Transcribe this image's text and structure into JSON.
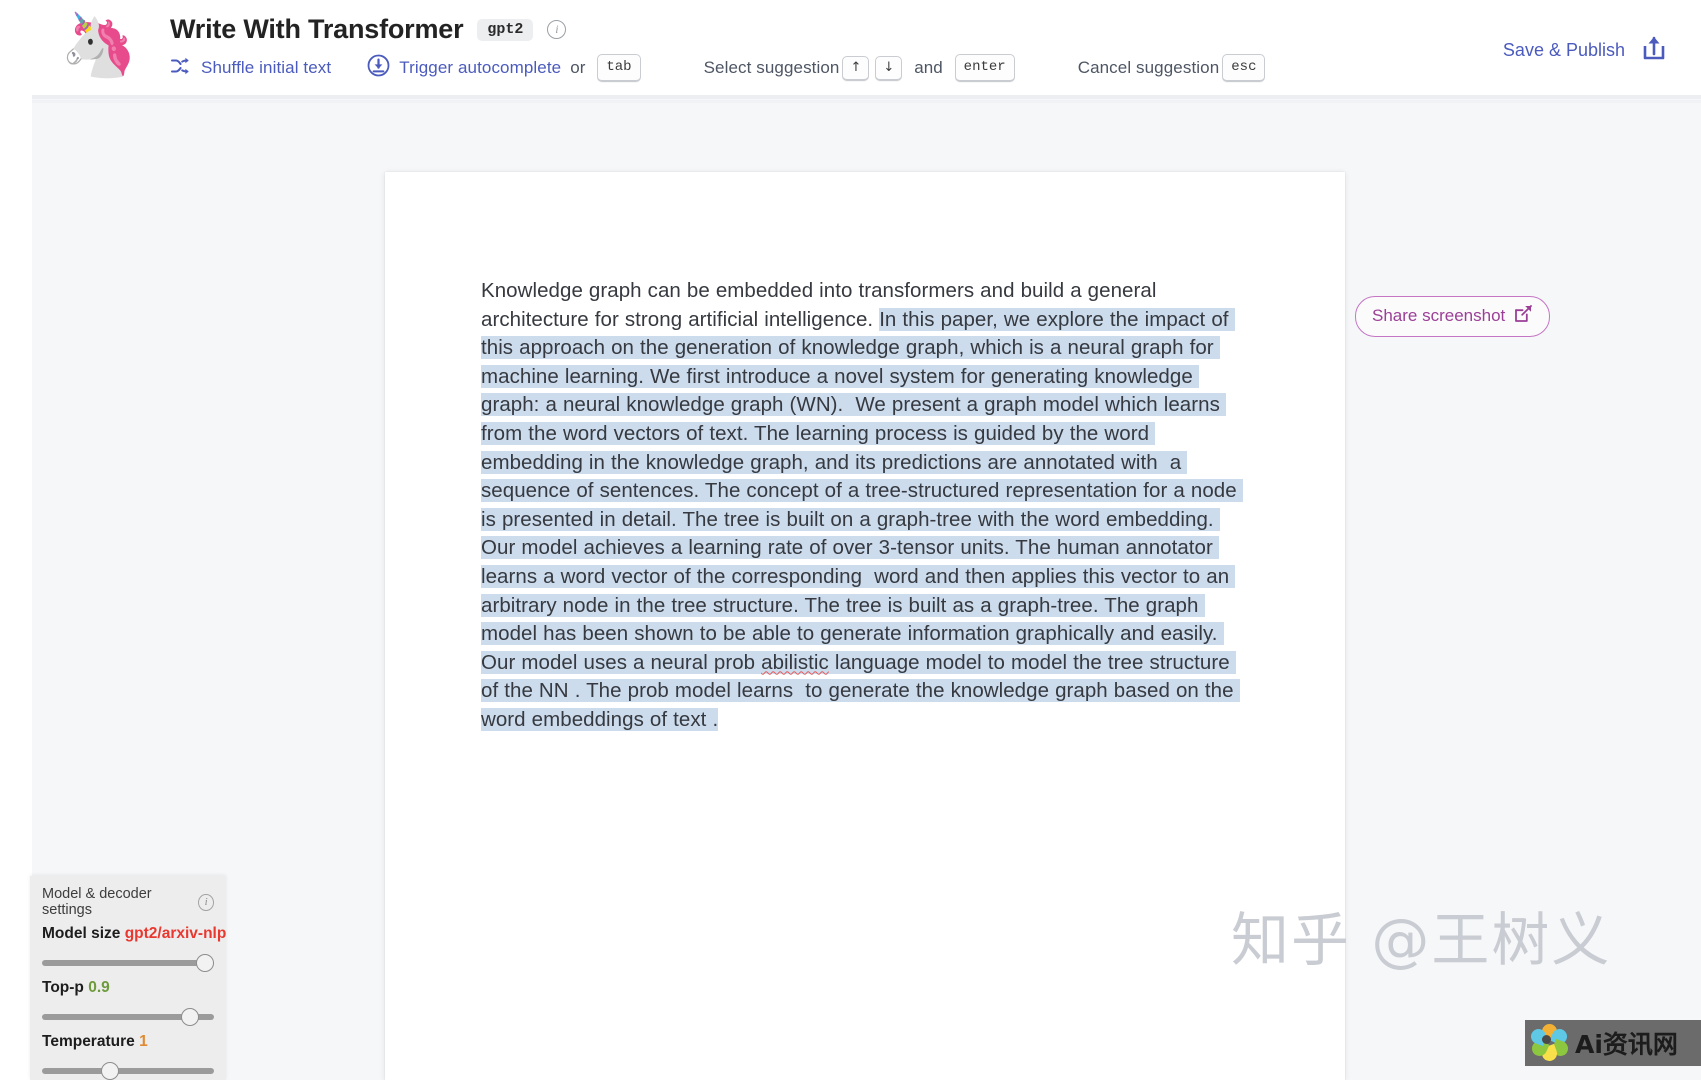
{
  "header": {
    "logo_icon": "unicorn-emoji",
    "logo_glyph": "🦄",
    "title": "Write With Transformer",
    "model_chip": "gpt2",
    "info_icon": "info-icon",
    "info_glyph": "i",
    "hints": [
      {
        "icon": "shuffle-icon",
        "label": "Shuffle initial text"
      },
      {
        "icon": "download-circle-icon",
        "label": "Trigger autocomplete",
        "conj": "or",
        "keys": [
          "tab"
        ]
      },
      {
        "icon": null,
        "label": "Select suggestion",
        "keys": [
          "↑",
          "↓"
        ],
        "conj2": "and",
        "keys2": [
          "enter"
        ]
      },
      {
        "icon": null,
        "label": "Cancel suggestion",
        "keys": [
          "esc"
        ]
      }
    ],
    "save_publish_label": "Save & Publish",
    "save_publish_icon": "share-upload-icon",
    "accent_blue": "#4b5bbd"
  },
  "share": {
    "label": "Share screenshot",
    "icon": "external-link-icon",
    "accent": "#9b3f96"
  },
  "editor": {
    "prompt_text": "Knowledge graph can be embedded into transformers and build a general architecture for strong artificial intelligence. ",
    "generated_part_1": "In this paper, we explore the impact of this approach on the generation of knowledge graph, which is a neural graph for machine learning. We first introduce a novel system for generating knowledge graph: a neural knowledge graph (WN).  We present a graph model which learns from the word vectors of text. The learning process is guided by the word embedding in the knowledge graph, and its predictions are annotated with  a sequence of sentences. The concept of a tree-structured representation for a node is presented in detail. The tree is built on a graph-tree with the word embedding. Our model achieves a learning rate of over 3-tensor units. The human annotator learns a word vector of the corresponding  word and then applies this vector to an arbitrary node in the tree structure. The tree is built as a graph-tree. The graph model has been shown to be able to generate information graphically and easily. Our model uses a neural prob ",
    "misspelled_word": "abilistic",
    "generated_part_2": " language model to model the tree structure of the NN . The prob model learns  to generate the knowledge graph based on the word embeddings of text .",
    "highlight_color": "#ccdced"
  },
  "settings": {
    "panel_title": "Model & decoder settings",
    "info_icon": "info-icon",
    "rows": [
      {
        "label": "Model size",
        "value": "gpt2/arxiv-nlp",
        "value_color": "#e8382f",
        "thumb_percent": 100
      },
      {
        "label": "Top-p",
        "value": "0.9",
        "value_color": "#6e9b3c",
        "thumb_percent": 90
      },
      {
        "label": "Temperature",
        "value": "1",
        "value_color": "#e08a34",
        "thumb_percent": 38
      }
    ]
  },
  "watermark": {
    "text": "知乎 @王树义",
    "badge_text": "Ai资讯网",
    "badge_icon": "flower-logo-icon"
  }
}
